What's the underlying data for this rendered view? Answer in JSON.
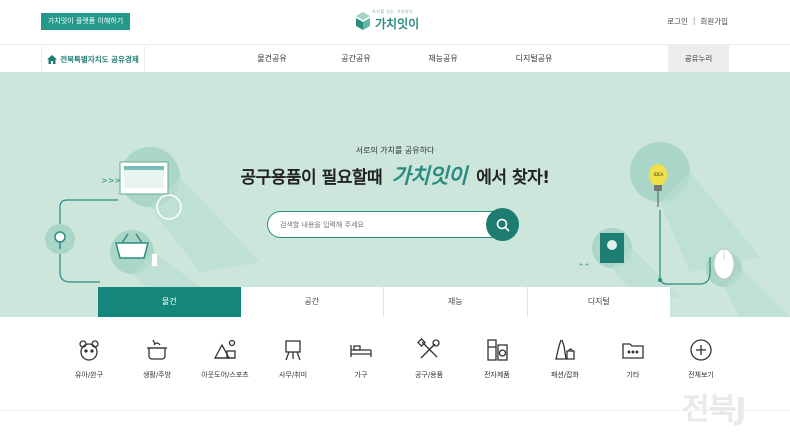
{
  "header": {
    "intro_button": "가치잇이 플랫폼 이해하기",
    "logo_sub": "가치를 잇는 가치잇이",
    "logo_text": "가치잇이",
    "login": "로그인",
    "separator": "|",
    "signup": "회원가입"
  },
  "nav": {
    "region": "전북특별자치도 공유경제",
    "menu": [
      "물건공유",
      "공간공유",
      "재능공유",
      "디지털공유"
    ],
    "nuri": "공유누리"
  },
  "hero": {
    "subtitle": "서로의 가치를 공유하다",
    "title_before": "공구용품이 필요할때",
    "title_brand": "가치잇이",
    "title_after": "에서 찾자!",
    "search_placeholder": "검색할 내용을 입력해 주세요",
    "idea_label": "IDEA"
  },
  "tabs": [
    "물건",
    "공간",
    "재능",
    "디지털"
  ],
  "active_tab": "물건",
  "categories": [
    {
      "label": "유아/완구",
      "icon": "toy-icon"
    },
    {
      "label": "생활/주방",
      "icon": "pot-icon"
    },
    {
      "label": "아웃도어/스포츠",
      "icon": "outdoor-icon"
    },
    {
      "label": "사무/취미",
      "icon": "easel-icon"
    },
    {
      "label": "가구",
      "icon": "bed-icon"
    },
    {
      "label": "공구/용품",
      "icon": "tools-icon"
    },
    {
      "label": "전자제품",
      "icon": "appliance-icon"
    },
    {
      "label": "패션/잡화",
      "icon": "fashion-icon"
    },
    {
      "label": "기타",
      "icon": "folder-icon"
    },
    {
      "label": "전체보기",
      "icon": "plus-circle-icon"
    }
  ],
  "colors": {
    "brand": "#2a8d80",
    "hero_bg": "#cce6dc",
    "active_tab": "#14867a"
  },
  "watermark": "전북J"
}
